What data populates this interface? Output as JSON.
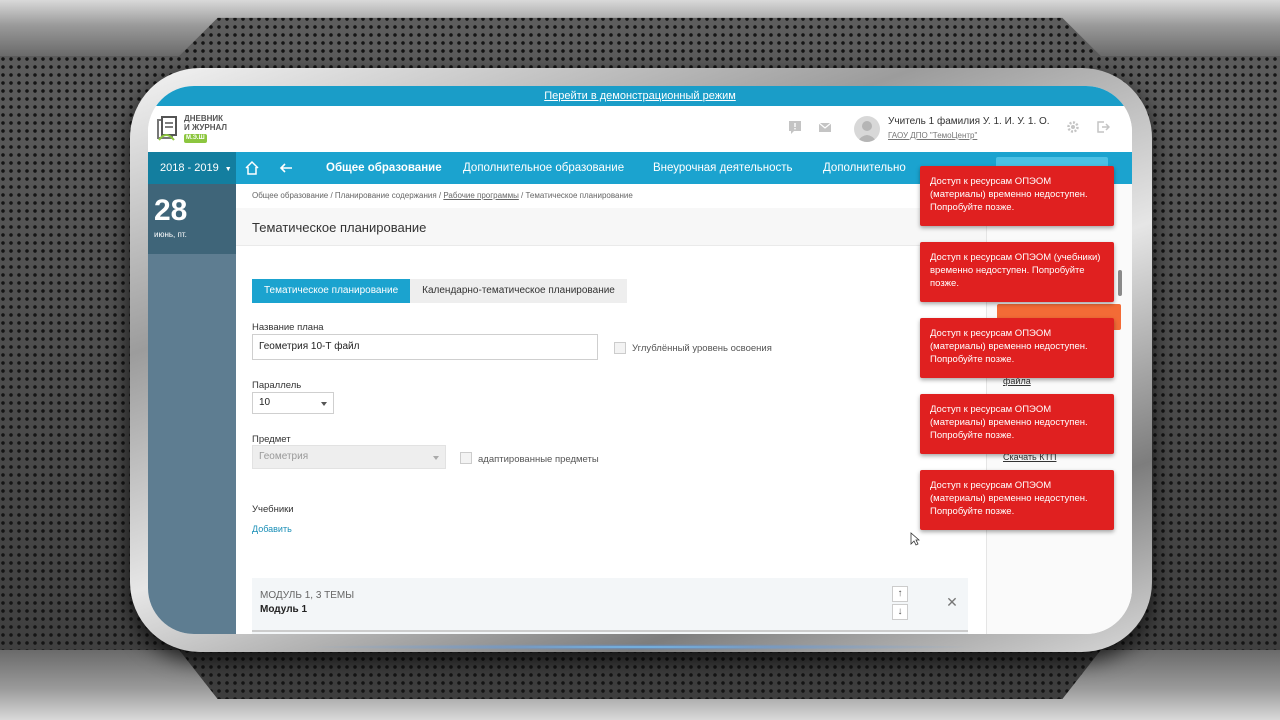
{
  "demo_bar": {
    "link": "Перейти в демонстрационный режим"
  },
  "header": {
    "logo_line1": "ДНЕВНИК",
    "logo_line2": "И ЖУРНАЛ",
    "logo_badge": "М.Э.Ш",
    "user_name": "Учитель 1 фамилия У. 1. И. У. 1. О.",
    "user_org": "ГАОУ ДПО \"ТемоЦентр\"",
    "icons": [
      "alert-icon",
      "mail-icon",
      "settings-icon",
      "logout-icon"
    ]
  },
  "nav": {
    "year": "2018 - 2019",
    "items": [
      "Общее образование",
      "Дополнительное образование",
      "Внеурочная деятельность",
      "Дополнительно"
    ],
    "active_index": 0
  },
  "sidebar": {
    "date_num": "28",
    "date_sub": "июнь, пт."
  },
  "breadcrumb": {
    "part1": "Общее образование / Планирование содержания / ",
    "link": "Рабочие программы",
    "part2": " / Тематическое планирование"
  },
  "page_title": "Тематическое планирование",
  "tabs": [
    "Тематическое планирование",
    "Календарно-тематическое планирование"
  ],
  "form": {
    "plan_name_label": "Название плана",
    "plan_name_value": "Геометрия 10-Т файл",
    "advanced_label": "Углублённый уровень освоения",
    "parallel_label": "Параллель",
    "parallel_value": "10",
    "subject_label": "Предмет",
    "subject_value": "Геометрия",
    "adapted_label": "адаптированные предметы",
    "textbooks_label": "Учебники",
    "add_link": "Добавить"
  },
  "module": {
    "title": "МОДУЛЬ 1,   3 ТЕМЫ",
    "subtitle": "Модуль 1"
  },
  "right_links": [
    "файла",
    "Скачать КТП"
  ],
  "toasts": [
    "Доступ к ресурсам ОПЭОМ (материалы) временно недоступен. Попробуйте позже.",
    "Доступ к ресурсам ОПЭОМ (учебники) временно недоступен. Попробуйте позже.",
    "Доступ к ресурсам ОПЭОМ (материалы) временно недоступен. Попробуйте позже.",
    "Доступ к ресурсам ОПЭОМ (материалы) временно недоступен. Попробуйте позже.",
    "Доступ к ресурсам ОПЭОМ (материалы) временно недоступен. Попробуйте позже."
  ],
  "colors": {
    "primary": "#1ba3cf",
    "sidebar": "#5e7d91",
    "toast": "#e02020",
    "accent_orange": "#f36b36"
  }
}
